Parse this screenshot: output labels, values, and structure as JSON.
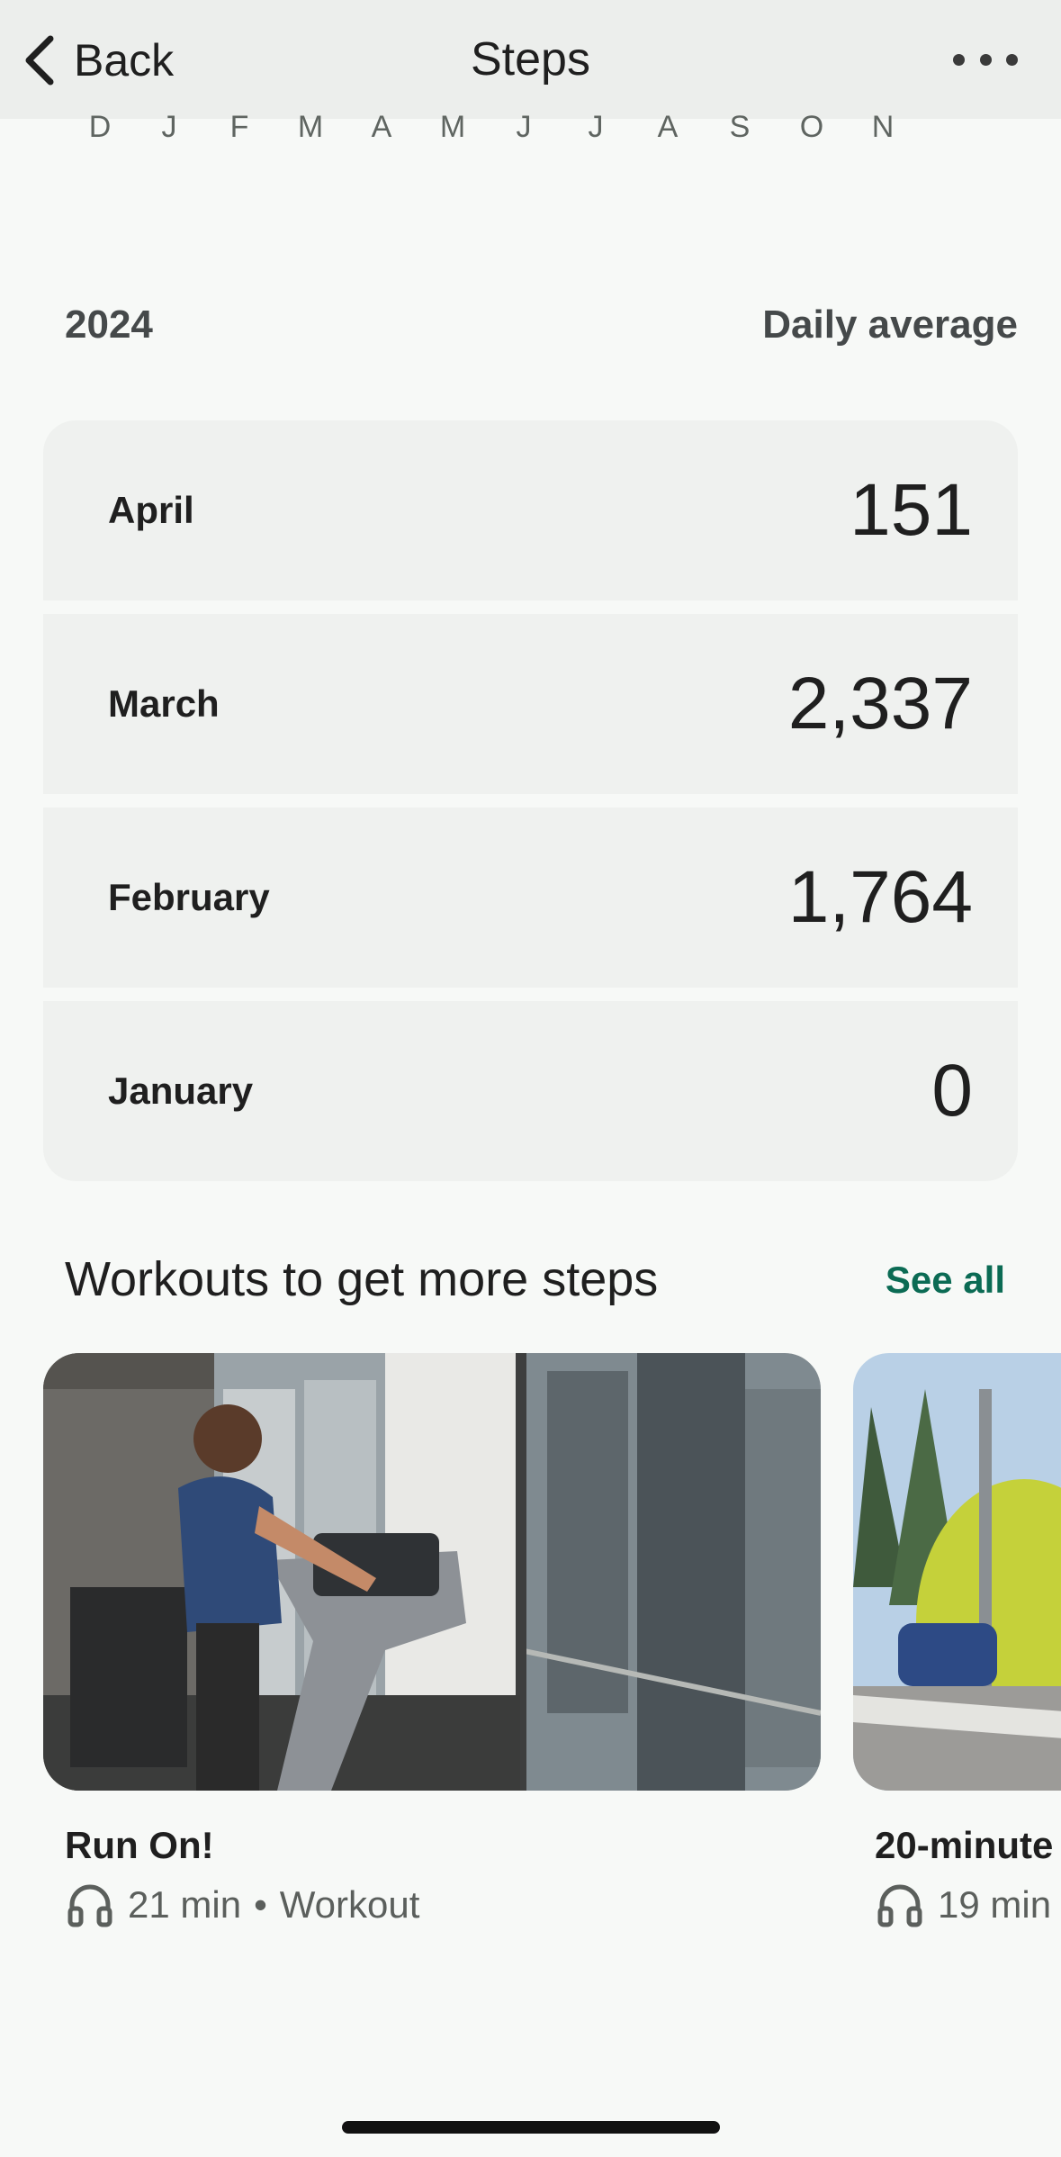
{
  "header": {
    "back_label": "Back",
    "title": "Steps",
    "more_icon": "more-horizontal-icon"
  },
  "chart_axis": {
    "month_initials": [
      "D",
      "J",
      "F",
      "M",
      "A",
      "M",
      "J",
      "J",
      "A",
      "S",
      "O",
      "N"
    ]
  },
  "summary": {
    "year": "2024",
    "metric_label": "Daily average"
  },
  "months": [
    {
      "name": "April",
      "value": "151"
    },
    {
      "name": "March",
      "value": "2,337"
    },
    {
      "name": "February",
      "value": "1,764"
    },
    {
      "name": "January",
      "value": "0"
    }
  ],
  "workouts_section": {
    "title": "Workouts to get more steps",
    "see_all_label": "See all",
    "items": [
      {
        "title": "Run On!",
        "duration": "21 min",
        "separator": "•",
        "type": "Workout",
        "icon": "headphones-icon"
      },
      {
        "title": "20-minute",
        "duration": "19 min",
        "icon": "headphones-icon"
      }
    ]
  },
  "colors": {
    "accent": "#0b6b54",
    "background": "#f7f9f7",
    "card": "#eff1ef",
    "header": "#eceeec"
  }
}
